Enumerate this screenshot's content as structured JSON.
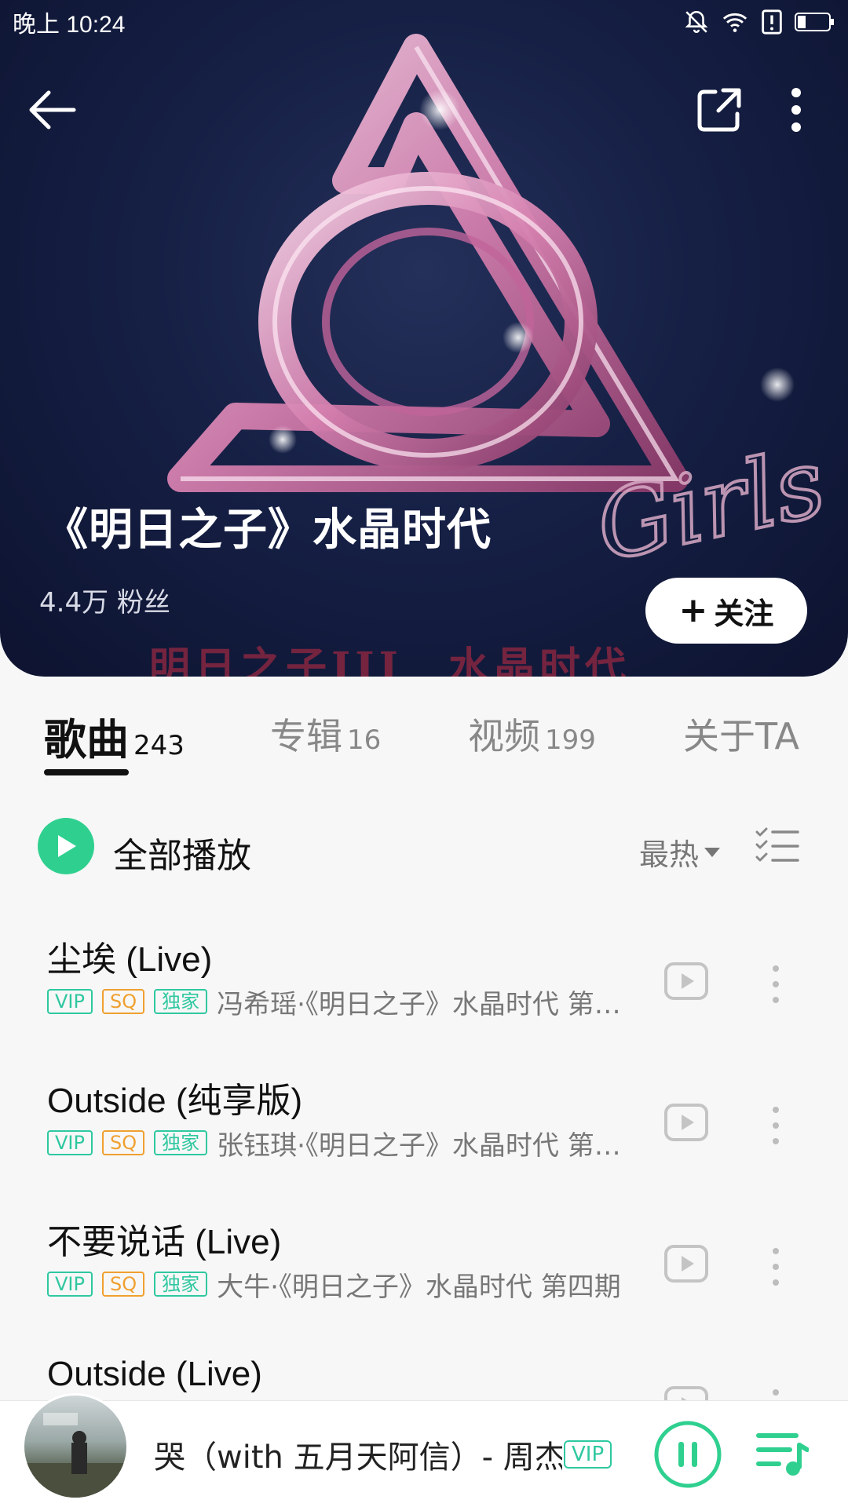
{
  "status_bar": {
    "time": "晚上 10:24",
    "icons": [
      "bell-off-icon",
      "wifi-icon",
      "alert-icon",
      "battery-icon"
    ]
  },
  "header": {
    "back_icon": "arrow-left-icon",
    "share_icon": "share-icon",
    "more_icon": "more-vertical-icon",
    "artist_name": "《明日之子》水晶时代",
    "fans": "4.4万 粉丝",
    "follow_label": "关注",
    "artwork_footer": "明日之子III　水晶时代",
    "artwork_script": "Girls"
  },
  "tabs": [
    {
      "label": "歌曲",
      "count": "243",
      "active": true
    },
    {
      "label": "专辑",
      "count": "16",
      "active": false
    },
    {
      "label": "视频",
      "count": "199",
      "active": false
    },
    {
      "label": "关于TA",
      "count": "",
      "active": false
    }
  ],
  "toolbar": {
    "play_all_label": "全部播放",
    "sort_label": "最热"
  },
  "badges": {
    "vip": "VIP",
    "sq": "SQ",
    "exclusive": "独家"
  },
  "songs": [
    {
      "title": "尘埃 (Live)",
      "subtitle": "冯希瑶·《明日之子》水晶时代 第…"
    },
    {
      "title": "Outside (纯享版)",
      "subtitle": "张钰琪·《明日之子》水晶时代 第…"
    },
    {
      "title": "不要说话 (Live)",
      "subtitle": "大牛·《明日之子》水晶时代 第四期"
    },
    {
      "title": "Outside (Live)",
      "subtitle": ""
    }
  ],
  "mini_player": {
    "track": "哭（with 五月天阿信）- 周杰伦",
    "vip": "VIP"
  },
  "colors": {
    "accent_green": "#2fd08f",
    "badge_orange": "#f0a030",
    "hero_bg": "#162045",
    "crystal_pink": "#e7a3c9"
  }
}
